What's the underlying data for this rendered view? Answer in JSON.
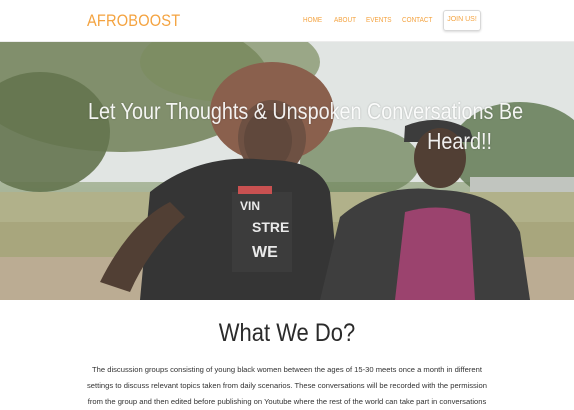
{
  "nav": {
    "brand": "AFROBOOST",
    "items": [
      "HOME",
      "ABOUT",
      "EVENTS",
      "CONTACT"
    ],
    "join_label": "JOIN US!"
  },
  "hero": {
    "title_line1": "Let Your Thoughts & Unspoken Conversations Be",
    "title_line2": "Heard!!"
  },
  "section": {
    "title": "What We Do?",
    "paragraph": "The discussion groups consisting of young black women between the ages of 15-30 meets once a month in different settings to discuss relevant topics taken from daily scenarios. These conversations will be recorded with the permission from the group and then edited before publishing on Youtube where the rest of the world can take part in conversations"
  },
  "colors": {
    "accent": "#f4a340",
    "text": "#2b2b2b"
  }
}
